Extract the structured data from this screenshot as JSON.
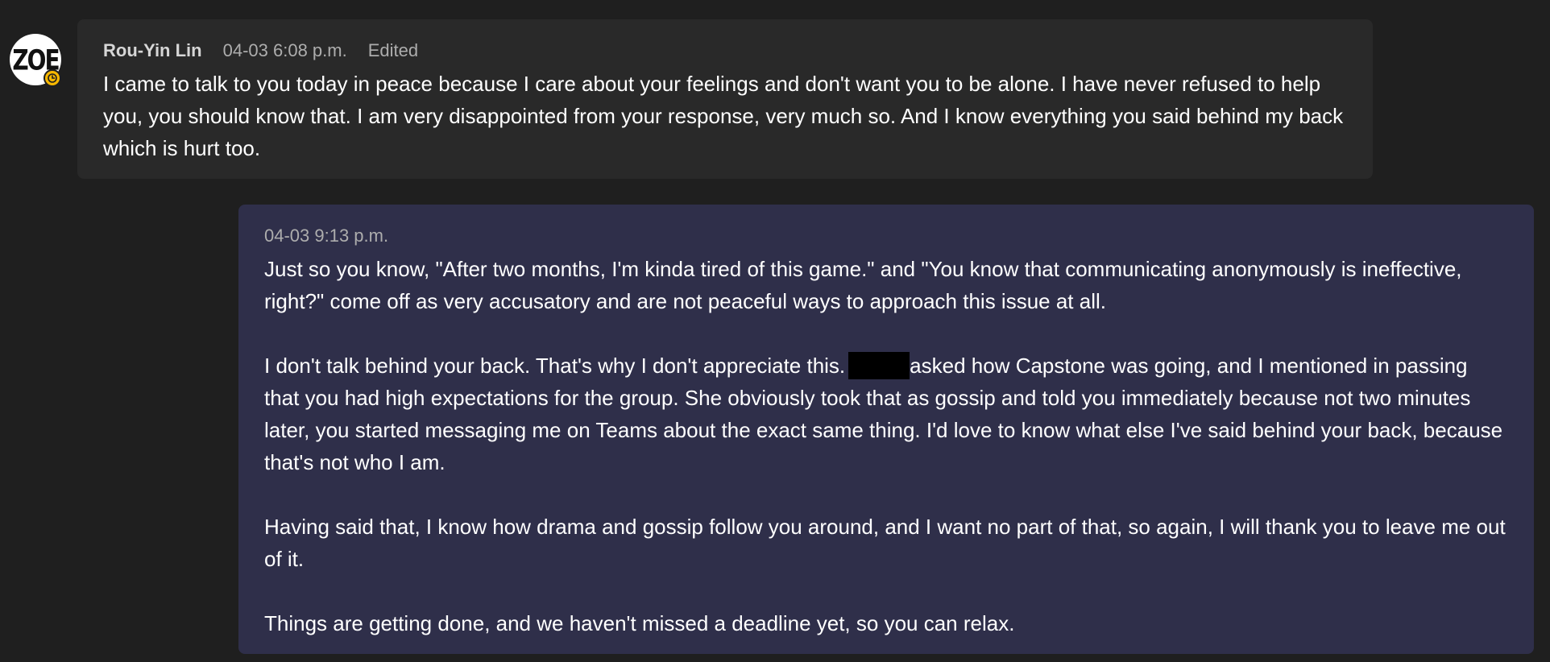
{
  "messages": {
    "incoming": {
      "sender": "Rou-Yin Lin",
      "timestamp": "04-03 6:08 p.m.",
      "edited_label": "Edited",
      "avatar_text": "ZOE",
      "avatar_status": "clock-icon",
      "body": "I came to talk to you today in peace because I care about your feelings and don't want you to be alone. I have never refused to help you, you should know that. I am very disappointed from your response, very much so. And I know everything you said behind my back which is hurt too."
    },
    "outgoing": {
      "timestamp": "04-03 9:13 p.m.",
      "paragraph_1": "Just so you know, \"After two months, I'm kinda tired of this game.\" and \"You know that communicating anonymously is ineffective, right?\" come off as very accusatory and are not peaceful ways to approach this issue at all.",
      "paragraph_2_before": "I don't talk behind your back. That's why I don't appreciate this.",
      "paragraph_2_after": "asked how Capstone was going, and I mentioned in passing that you had high expectations for the group. She obviously took that as gossip and told you immediately because not two minutes later, you started messaging me on Teams about the exact same thing. I'd love to know what else I've said behind your back, because that's not who I am.",
      "paragraph_3": "Having said that, I know how drama and gossip follow you around, and I want no part of that, so again, I will thank you to leave me out of it.",
      "paragraph_4": "Things are getting done, and we haven't missed a deadline yet, so you can relax."
    }
  },
  "colors": {
    "background": "#1f1f1f",
    "incoming_bubble": "#292929",
    "outgoing_bubble": "#2f2f4a",
    "status_badge": "#f8b800"
  }
}
